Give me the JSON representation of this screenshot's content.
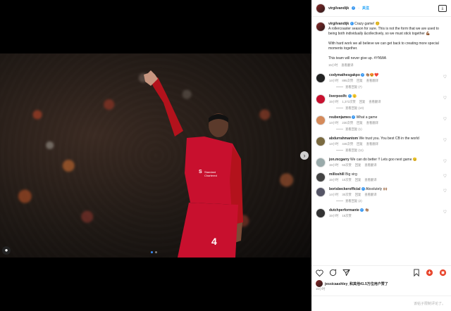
{
  "post": {
    "author": "virgilvandijk",
    "follow_label": "关注",
    "caption_lines": [
      "Crazy game! 😵‍💫",
      "A rollercoaster season for sure. This is not the form that we are used to being both individually &collectively, so we must stick together 💪🏾",
      "With hard work we all believe we can get back to creating more special moments together.",
      "This team will never give up. #YNWA"
    ],
    "caption_time": "15小时",
    "caption_action": "查看翻译"
  },
  "comments": [
    {
      "user": "codymathesgakpo",
      "verified": true,
      "text": "👏🏽😍❤️",
      "time": "14小时",
      "likes": "895次赞",
      "reply": "回复",
      "translate": "查看翻译",
      "replies": "查看回复 (7)",
      "avatar_color": "#222"
    },
    {
      "user": "liverpoolfc",
      "verified": true,
      "text": "🫡",
      "time": "15小时",
      "likes": "1,372次赞",
      "reply": "回复",
      "translate": "查看翻译",
      "replies": "查看回复 (10)",
      "avatar_color": "#c8102e"
    },
    {
      "user": "reubenjames",
      "verified": true,
      "text": "What a game",
      "time": "14小时",
      "likes": "230次赞",
      "reply": "回复",
      "translate": "查看翻译",
      "replies": "查看回复 (1)",
      "avatar_color": "#d58a5a"
    },
    {
      "user": "abdurrahmantom",
      "verified": false,
      "text": "We trust you. You best CB in the world",
      "time": "14小时",
      "likes": "446次赞",
      "reply": "回复",
      "translate": "查看翻译",
      "replies": "查看回复 (11)",
      "avatar_color": "#7a6a40"
    },
    {
      "user": "jon.mcgarry",
      "verified": false,
      "text": "We can do better !! Lets goo next game 😉",
      "time": "15小时",
      "likes": "63次赞",
      "reply": "回复",
      "translate": "查看翻译",
      "replies": "",
      "avatar_color": "#9aa"
    },
    {
      "user": "milloshill",
      "verified": false,
      "text": "Big virg",
      "time": "15小时",
      "likes": "10次赞",
      "reply": "回复",
      "translate": "查看翻译",
      "replies": "",
      "avatar_color": "#444"
    },
    {
      "user": "borisbeckerofficial",
      "verified": true,
      "text": "Absolutely 🙌🏽",
      "time": "14小时",
      "likes": "30次赞",
      "reply": "回复",
      "translate": "查看翻译",
      "replies": "查看回复 (2)",
      "avatar_color": "#556"
    },
    {
      "user": "dutchperformante",
      "verified": true,
      "text": "👏🏽",
      "time": "15小时",
      "likes": "16次赞",
      "reply": "",
      "translate": "",
      "replies": "",
      "avatar_color": "#333"
    }
  ],
  "actions": {
    "like_icon": "heart-icon",
    "comment_icon": "comment-icon",
    "share_icon": "share-icon",
    "save_icon": "bookmark-icon"
  },
  "likes_line": "jessicaashley_和其他41.5万位用户赞了",
  "post_time": "15小时",
  "add_comment_placeholder": "该帖子限制评论了。"
}
